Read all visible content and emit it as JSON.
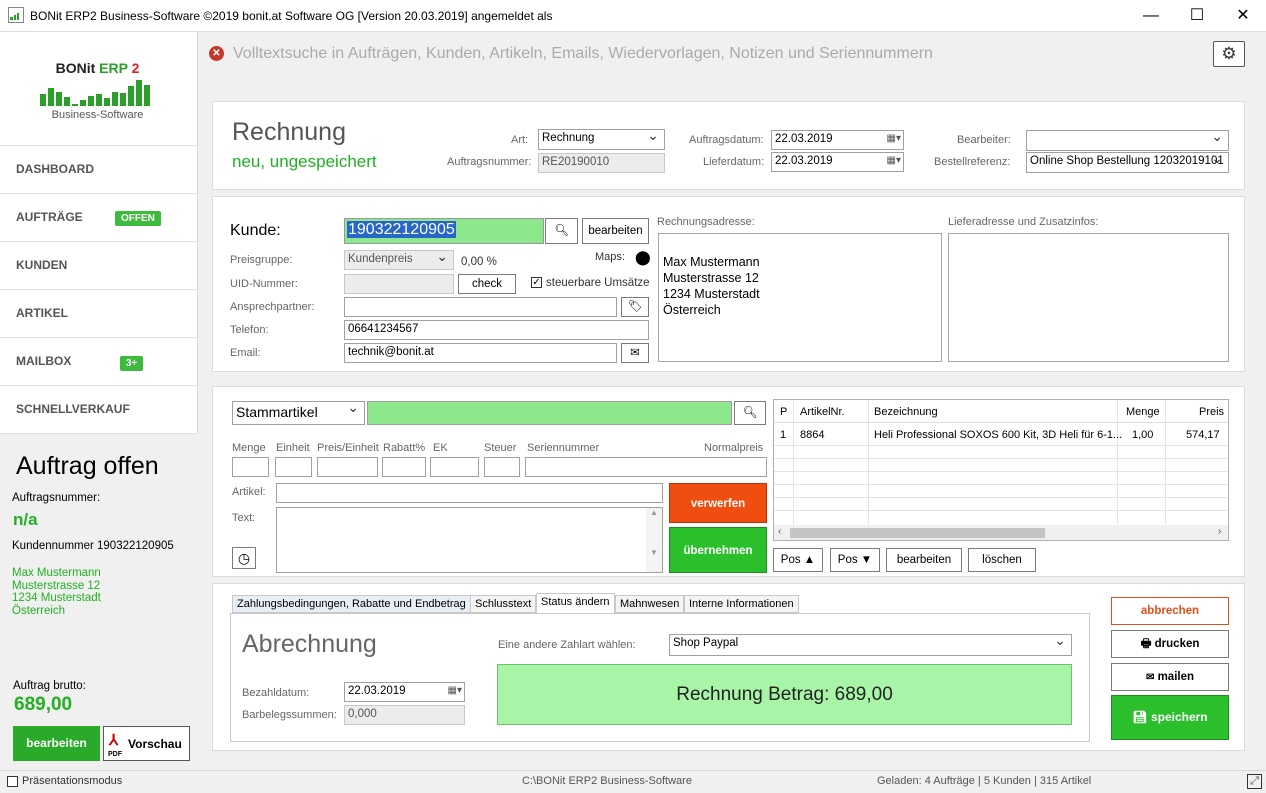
{
  "window": {
    "title": "BONit ERP2 Business-Software ©2019 bonit.at Software OG [Version 20.03.2019] angemeldet als",
    "minimize": "—",
    "maximize": "☐",
    "close": "✕"
  },
  "search": {
    "placeholder": "Volltextsuche in Aufträgen, Kunden, Artikeln, Emails, Wiedervorlagen, Notizen und Seriennummern"
  },
  "logo": {
    "part1": "BONit",
    "part2": "ERP",
    "part3": "2",
    "subtitle": "Business-Software",
    "bars": [
      12,
      18,
      14,
      9,
      2,
      6,
      10,
      12,
      8,
      14,
      13,
      20,
      26,
      21
    ]
  },
  "nav": [
    {
      "label": "DASHBOARD"
    },
    {
      "label": "AUFTRÄGE",
      "badge": "OFFEN"
    },
    {
      "label": "KUNDEN"
    },
    {
      "label": "ARTIKEL"
    },
    {
      "label": "MAILBOX",
      "badge": "3+"
    },
    {
      "label": "SCHNELLVERKAUF"
    }
  ],
  "side": {
    "status": "Auftrag offen",
    "order_label": "Auftragsnummer:",
    "order_value": "n/a",
    "customer_no": "Kundennummer 190322120905",
    "address": [
      "Max Mustermann",
      "Musterstrasse 12",
      "1234 Musterstadt",
      "Österreich"
    ],
    "gross_label": "Auftrag brutto:",
    "gross_value": "689,00",
    "edit": "bearbeiten",
    "pdf_icon": "PDF",
    "preview": "Vorschau"
  },
  "header": {
    "doc_type": "Rechnung",
    "state": "neu, ungespeichert",
    "art_label": "Art:",
    "art_value": "Rechnung",
    "order_no_label": "Auftragsnummer:",
    "order_no_value": "RE20190010",
    "order_date_label": "Auftragsdatum:",
    "order_date_value": "22.03.2019",
    "delivery_date_label": "Lieferdatum:",
    "delivery_date_value": "22.03.2019",
    "editor_label": "Bearbeiter:",
    "editor_value": "",
    "order_ref_label": "Bestellreferenz:",
    "order_ref_value": "Online Shop Bestellung 12032019101"
  },
  "customer": {
    "label": "Kunde:",
    "id": "190322120905",
    "edit": "bearbeiten",
    "price_group_label": "Preisgruppe:",
    "price_group_value": "Kundenpreis",
    "discount": "0,00 %",
    "maps_label": "Maps:",
    "uid_label": "UID-Nummer:",
    "check": "check",
    "taxable": "steuerbare Umsätze",
    "contact_label": "Ansprechpartner:",
    "contact_value": "",
    "phone_label": "Telefon:",
    "phone_value": "06641234567",
    "email_label": "Email:",
    "email_value": "technik@bonit.at",
    "billing_label": "Rechnungsadresse:",
    "billing": [
      "Max Mustermann",
      "Musterstrasse 12",
      "1234 Musterstadt",
      "Österreich"
    ],
    "delivery_label": "Lieferadresse und Zusatzinfos:"
  },
  "item_entry": {
    "type": "Stammartikel",
    "cols": [
      "Menge",
      "Einheit",
      "Preis/Einheit",
      "Rabatt%",
      "EK",
      "Steuer",
      "Seriennummer",
      "Normalpreis"
    ],
    "article_label": "Artikel:",
    "text_label": "Text:",
    "discard": "verwerfen",
    "accept": "übernehmen"
  },
  "positions": {
    "headers": [
      "P",
      "ArtikelNr.",
      "Bezeichnung",
      "Menge",
      "Preis"
    ],
    "rows": [
      {
        "p": "1",
        "nr": "8864",
        "name": "Heli Professional SOXOS 600 Kit, 3D Heli für 6-1...",
        "qty": "1,00",
        "price": "574,17"
      }
    ],
    "pos_up": "Pos ▲",
    "pos_down": "Pos ▼",
    "edit": "bearbeiten",
    "delete": "löschen"
  },
  "tabs": [
    "Zahlungsbedingungen, Rabatte  und Endbetrag",
    "Schlusstext",
    "Status ändern",
    "Mahnwesen",
    "Interne Informationen"
  ],
  "billing_tab": {
    "title": "Abrechnung",
    "paymode_label": "Eine andere Zahlart wählen:",
    "paymode_value": "Shop Paypal",
    "paydate_label": "Bezahldatum:",
    "paydate_value": "22.03.2019",
    "cash_label": "Barbelegssummen:",
    "cash_value": "0,000",
    "amount_text": "Rechnung  Betrag: 689,00"
  },
  "actions": {
    "cancel": "abbrechen",
    "print": "drucken",
    "mail": "mailen",
    "save": "speichern"
  },
  "statusbar": {
    "presentation": "Präsentationsmodus",
    "path": "C:\\BONit ERP2 Business-Software",
    "loaded": "Geladen: 4 Aufträge | 5 Kunden | 315 Artikel"
  }
}
